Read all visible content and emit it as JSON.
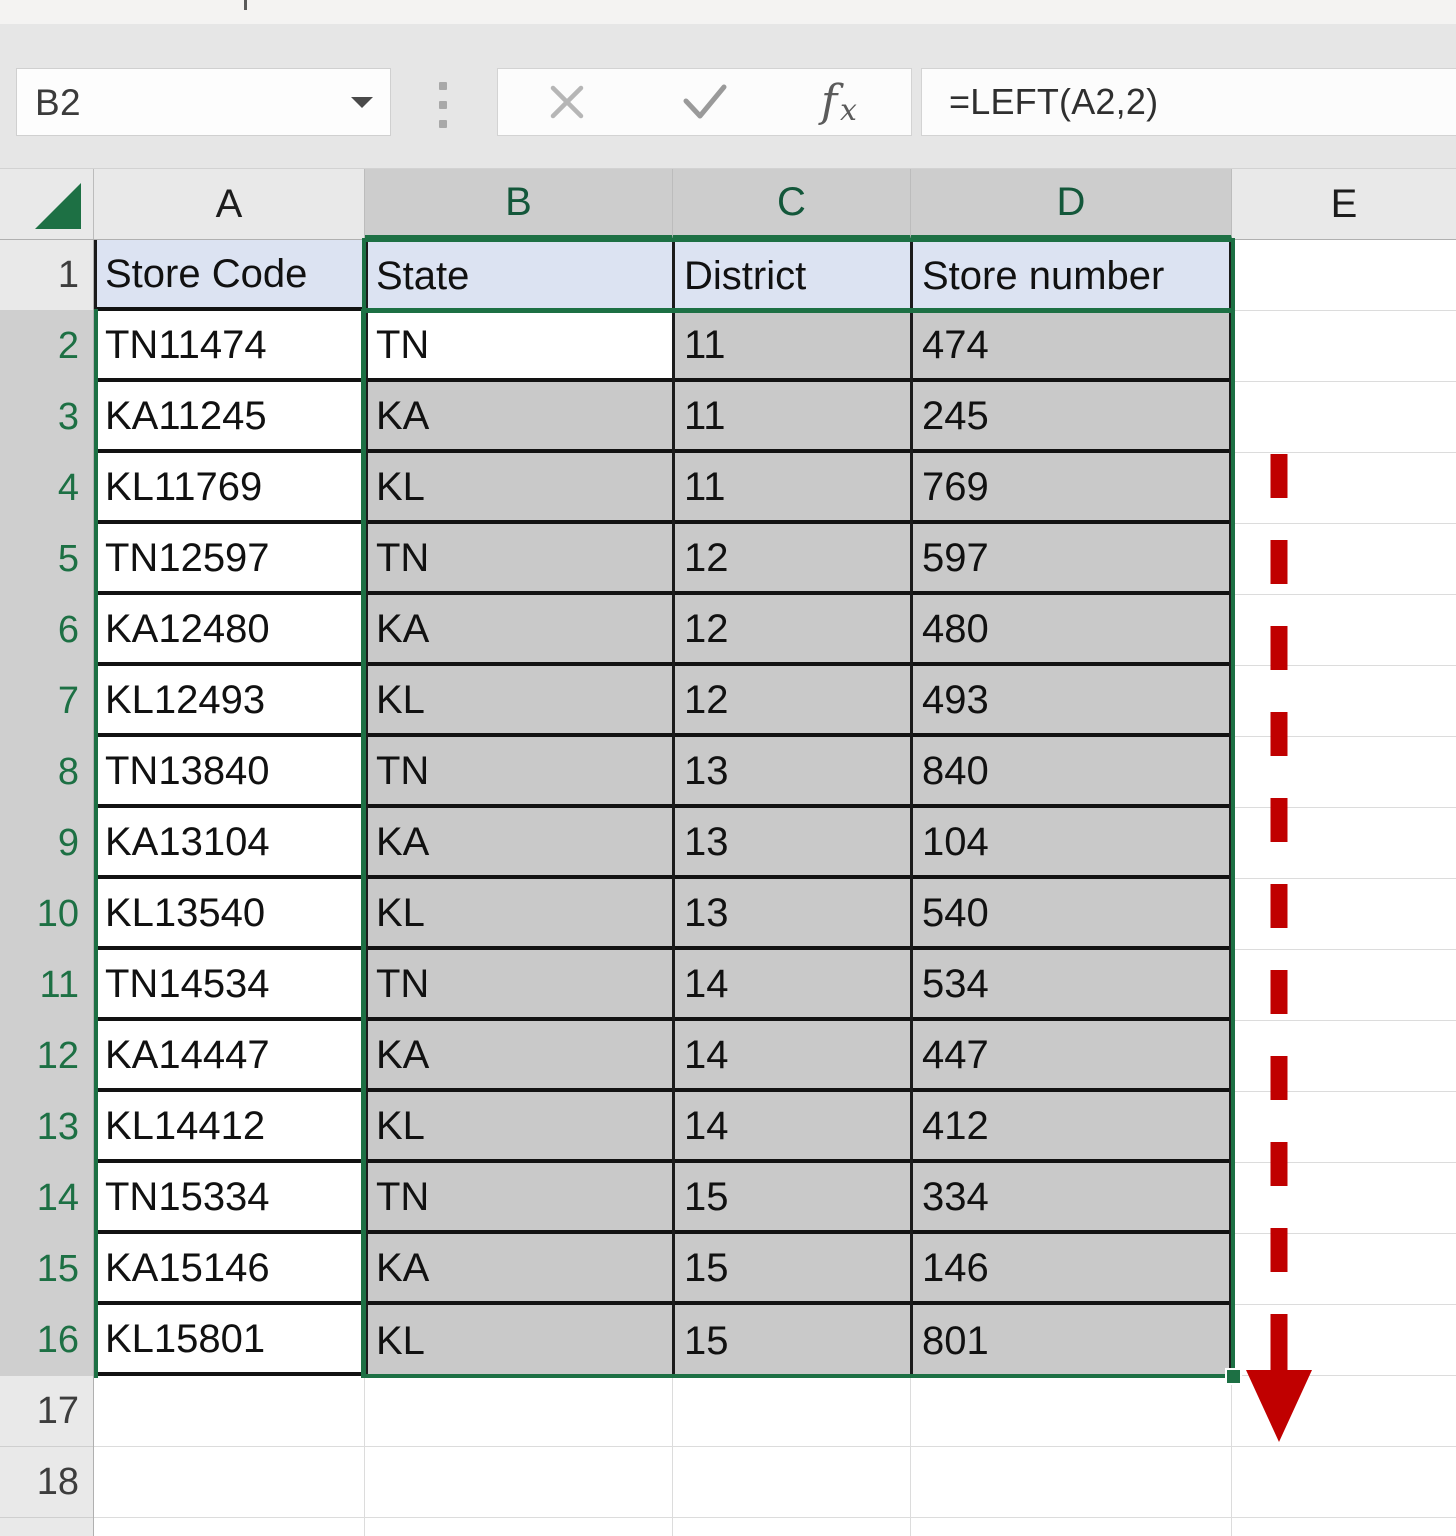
{
  "app": {
    "name": "Microsoft Excel",
    "accent_green": "#1d7044",
    "selection_fill": "#c9c9c9",
    "header_row_fill": "#dce3f2",
    "annotation_color": "#c00000"
  },
  "formula_bar": {
    "name_box_value": "B2",
    "name_box_dropdown_icon": "chevron-down-icon",
    "grip_icon": "vertical-dots-grip-icon",
    "cancel_icon": "cancel-x-icon",
    "enter_icon": "enter-check-icon",
    "insert_function_icon": "fx-icon",
    "formula_value": "=LEFT(A2,2)",
    "formula_placeholder": ""
  },
  "grid": {
    "column_headers": [
      "A",
      "B",
      "C",
      "D",
      "E"
    ],
    "selected_columns": [
      "B",
      "C",
      "D"
    ],
    "row_headers": [
      "1",
      "2",
      "3",
      "4",
      "5",
      "6",
      "7",
      "8",
      "9",
      "10",
      "11",
      "12",
      "13",
      "14",
      "15",
      "16",
      "17",
      "18"
    ],
    "selected_rows": [
      "2",
      "3",
      "4",
      "5",
      "6",
      "7",
      "8",
      "9",
      "10",
      "11",
      "12",
      "13",
      "14",
      "15",
      "16"
    ],
    "select_all_icon": "select-all-corner-icon",
    "active_cell": "B2",
    "selection_range": "B2:D16",
    "header_range": "B1:D1",
    "fill_handle_icon": "fill-handle-icon"
  },
  "table": {
    "headers": [
      "Store Code",
      "State",
      "District",
      "Store number"
    ],
    "rows": [
      {
        "row": "2",
        "store_code": "TN11474",
        "state": "TN",
        "district": "11",
        "store_number": "474"
      },
      {
        "row": "3",
        "store_code": "KA11245",
        "state": "KA",
        "district": "11",
        "store_number": "245"
      },
      {
        "row": "4",
        "store_code": "KL11769",
        "state": "KL",
        "district": "11",
        "store_number": "769"
      },
      {
        "row": "5",
        "store_code": "TN12597",
        "state": "TN",
        "district": "12",
        "store_number": "597"
      },
      {
        "row": "6",
        "store_code": "KA12480",
        "state": "KA",
        "district": "12",
        "store_number": "480"
      },
      {
        "row": "7",
        "store_code": "KL12493",
        "state": "KL",
        "district": "12",
        "store_number": "493"
      },
      {
        "row": "8",
        "store_code": "TN13840",
        "state": "TN",
        "district": "13",
        "store_number": "840"
      },
      {
        "row": "9",
        "store_code": "KA13104",
        "state": "KA",
        "district": "13",
        "store_number": "104"
      },
      {
        "row": "10",
        "store_code": "KL13540",
        "state": "KL",
        "district": "13",
        "store_number": "540"
      },
      {
        "row": "11",
        "store_code": "TN14534",
        "state": "TN",
        "district": "14",
        "store_number": "534"
      },
      {
        "row": "12",
        "store_code": "KA14447",
        "state": "KA",
        "district": "14",
        "store_number": "447"
      },
      {
        "row": "13",
        "store_code": "KL14412",
        "state": "KL",
        "district": "14",
        "store_number": "412"
      },
      {
        "row": "14",
        "store_code": "TN15334",
        "state": "TN",
        "district": "15",
        "store_number": "334"
      },
      {
        "row": "15",
        "store_code": "KA15146",
        "state": "KA",
        "district": "15",
        "store_number": "146"
      },
      {
        "row": "16",
        "store_code": "KL15801",
        "state": "KL",
        "district": "15",
        "store_number": "801"
      }
    ],
    "empty_rows": [
      "17",
      "18"
    ]
  },
  "annotation": {
    "type": "red-dashed-down-arrow",
    "direction": "down",
    "color": "#c00000"
  }
}
